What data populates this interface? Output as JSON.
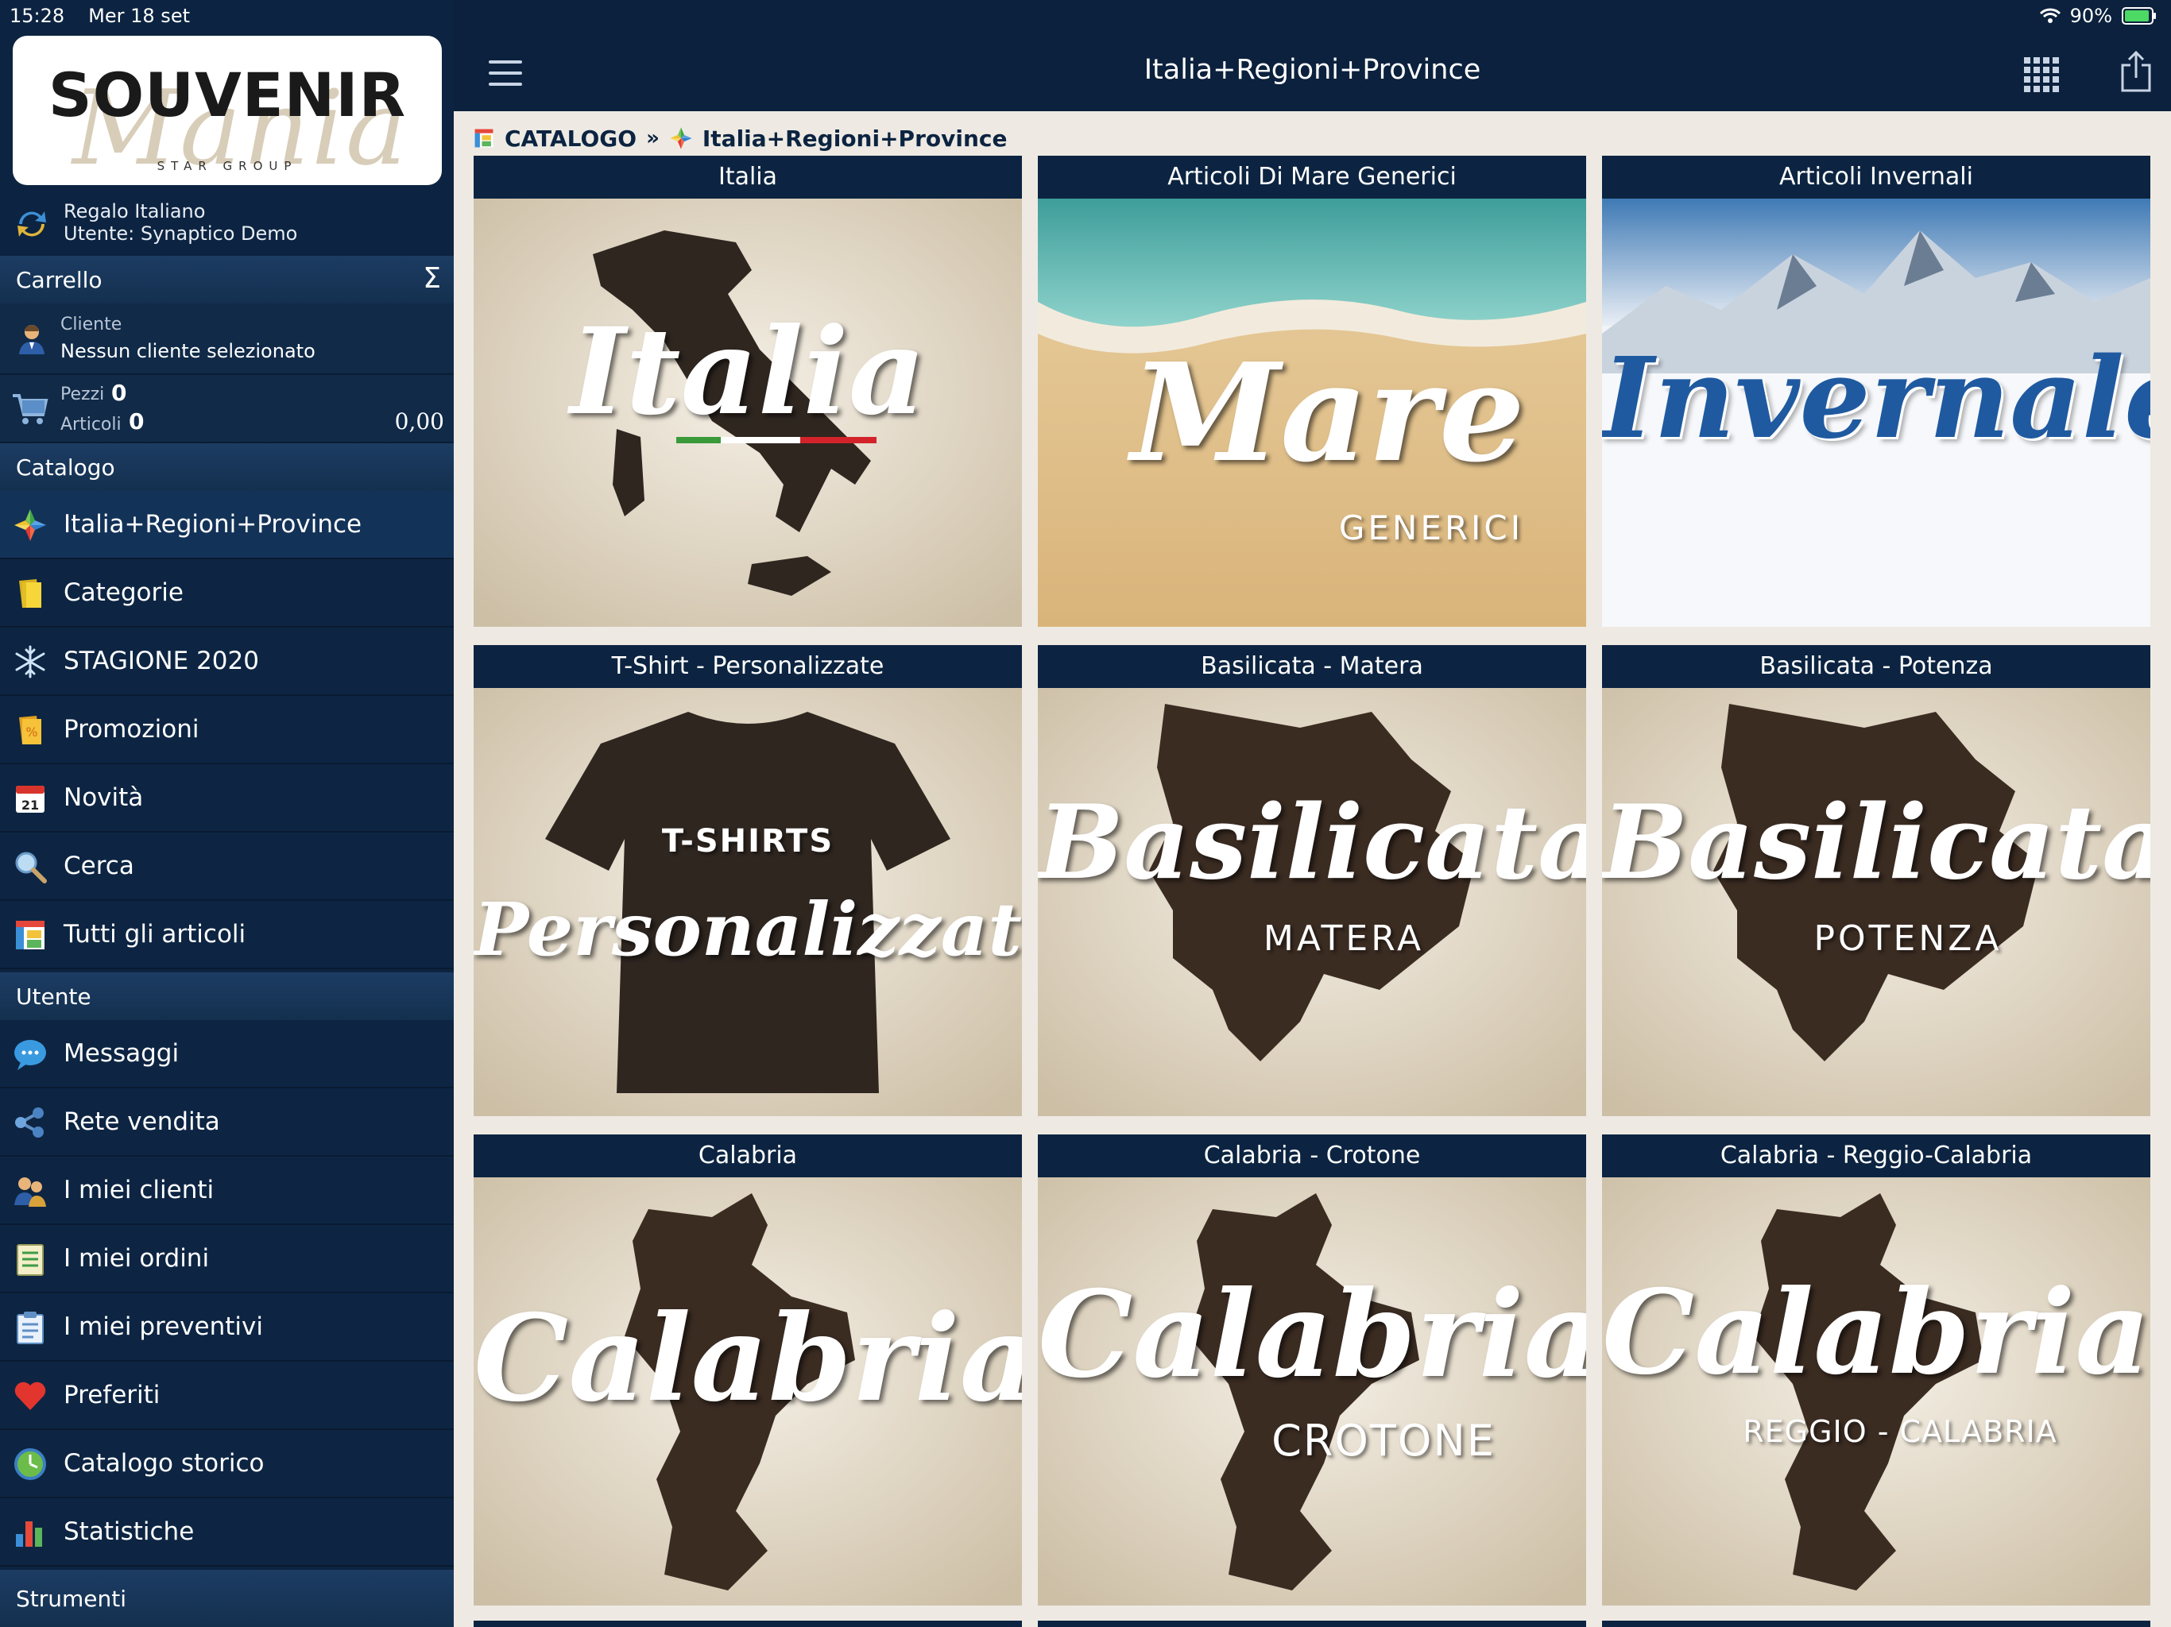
{
  "status": {
    "time": "15:28",
    "date": "Mer 18 set",
    "battery": "90%"
  },
  "logo": {
    "main": "SOUVENIR",
    "script": "Mania",
    "sub": "STAR GROUP"
  },
  "company": {
    "name": "Regalo Italiano",
    "user": "Utente: Synaptico Demo"
  },
  "cart": {
    "header": "Carrello",
    "sigma": "Σ",
    "customer_label": "Cliente",
    "customer_value": "Nessun cliente selezionato",
    "pieces_label": "Pezzi",
    "pieces_value": "0",
    "articles_label": "Articoli",
    "articles_value": "0",
    "total": "0,00"
  },
  "catalog_section": "Catalogo",
  "catalog_menu": [
    {
      "label": "Italia+Regioni+Province",
      "icon": "regions-icon"
    },
    {
      "label": "Categorie",
      "icon": "categories-icon"
    },
    {
      "label": "STAGIONE 2020",
      "icon": "snowflake-icon"
    },
    {
      "label": "Promozioni",
      "icon": "promo-icon"
    },
    {
      "label": "Novità",
      "icon": "calendar-icon",
      "day": "21"
    },
    {
      "label": "Cerca",
      "icon": "search-icon"
    },
    {
      "label": "Tutti gli articoli",
      "icon": "all-items-icon"
    }
  ],
  "user_section": "Utente",
  "user_menu": [
    {
      "label": "Messaggi",
      "icon": "messages-icon"
    },
    {
      "label": "Rete vendita",
      "icon": "share-network-icon"
    },
    {
      "label": "I miei clienti",
      "icon": "clients-icon"
    },
    {
      "label": "I miei ordini",
      "icon": "orders-icon"
    },
    {
      "label": "I miei preventivi",
      "icon": "quotes-icon"
    },
    {
      "label": "Preferiti",
      "icon": "heart-icon"
    },
    {
      "label": "Catalogo storico",
      "icon": "history-icon"
    },
    {
      "label": "Statistiche",
      "icon": "stats-icon"
    }
  ],
  "tools_section": "Strumenti",
  "topbar": {
    "title": "Italia+Regioni+Province"
  },
  "breadcrumb": {
    "root": "CATALOGO",
    "sep": "»",
    "current": "Italia+Regioni+Province"
  },
  "tiles": [
    {
      "title": "Italia",
      "script": "Italia",
      "sub": ""
    },
    {
      "title": "Articoli Di Mare Generici",
      "script": "Mare",
      "sub": "GENERICI"
    },
    {
      "title": "Articoli Invernali",
      "script": "Invernale",
      "sub": ""
    },
    {
      "title": "T-Shirt - Personalizzate",
      "script": "Personalizzate",
      "sub": "T-SHIRTS"
    },
    {
      "title": "Basilicata - Matera",
      "script": "Basilicata",
      "sub": "MATERA"
    },
    {
      "title": "Basilicata - Potenza",
      "script": "Basilicata",
      "sub": "POTENZA"
    },
    {
      "title": "Calabria",
      "script": "Calabria",
      "sub": ""
    },
    {
      "title": "Calabria - Crotone",
      "script": "Calabria",
      "sub": "CROTONE"
    },
    {
      "title": "Calabria - Reggio-Calabria",
      "script": "Calabria",
      "sub": "REGGIO - CALABRIA"
    }
  ]
}
